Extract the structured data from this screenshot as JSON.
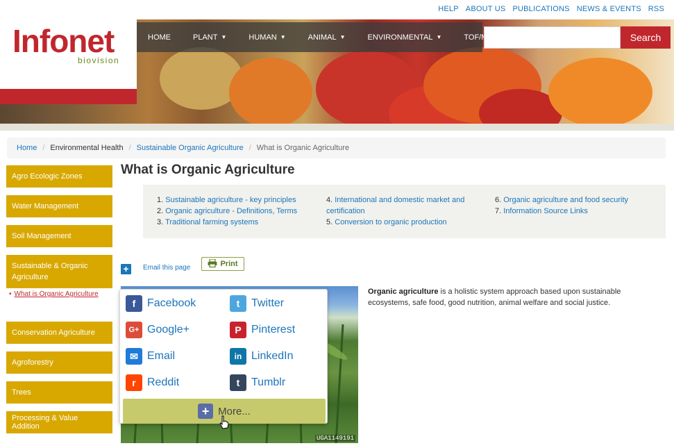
{
  "util_links": [
    "HELP",
    "ABOUT US",
    "PUBLICATIONS",
    "NEWS & EVENTS",
    "RSS"
  ],
  "logo": {
    "main": "Infonet",
    "sub": "biovision"
  },
  "nav": [
    {
      "label": "HOME",
      "dropdown": false
    },
    {
      "label": "PLANT",
      "dropdown": true
    },
    {
      "label": "HUMAN",
      "dropdown": true
    },
    {
      "label": "ANIMAL",
      "dropdown": true
    },
    {
      "label": "ENVIRONMENTAL",
      "dropdown": true
    },
    {
      "label": "TOF/MKM",
      "dropdown": false
    }
  ],
  "search": {
    "value": "",
    "placeholder": "",
    "button": "Search"
  },
  "breadcrumb": [
    {
      "label": "Home",
      "link": true
    },
    {
      "label": "Environmental Health",
      "link": false
    },
    {
      "label": "Sustainable Organic Agriculture",
      "link": true
    },
    {
      "label": "What is Organic Agriculture",
      "link": false,
      "current": true
    }
  ],
  "sidebar": {
    "items_top": [
      "Agro Ecologic Zones",
      "Water Management",
      "Soil Management",
      "Sustainable & Organic Agriculture"
    ],
    "active_sub": "What is Organic Agriculture",
    "items_bottom": [
      "Conservation Agriculture",
      "Agroforestry",
      "Trees",
      "Processing & Value Addition"
    ]
  },
  "page_title": "What is Organic Agriculture",
  "toc": {
    "col1": [
      {
        "n": "1.",
        "label": "Sustainable agriculture - key principles"
      },
      {
        "n": "2.",
        "label": "Organic agriculture - Definitions, Terms"
      },
      {
        "n": "3.",
        "label": "Traditional farming systems"
      }
    ],
    "col2": [
      {
        "n": "4.",
        "label": "International and domestic market and certification"
      },
      {
        "n": "5.",
        "label": "Conversion to organic production"
      }
    ],
    "col3": [
      {
        "n": "6.",
        "label": "Organic agriculture and food security"
      },
      {
        "n": "7.",
        "label": "Information Source Links"
      }
    ]
  },
  "share": {
    "email_label": "Email this page",
    "print_label": "Print"
  },
  "photo_id": "UGA1149191",
  "article": {
    "bold": "Organic agriculture",
    "text": " is a holistic system approach based upon sustainable ecosystems, safe food, good nutrition, animal welfare and social justice."
  },
  "share_popup": {
    "items": [
      {
        "label": "Facebook",
        "icon": "facebook-icon",
        "color": "#3b5998",
        "glyph": "f"
      },
      {
        "label": "Twitter",
        "icon": "twitter-icon",
        "color": "#4da7de",
        "glyph": "t"
      },
      {
        "label": "Google+",
        "icon": "googleplus-icon",
        "color": "#dd4b39",
        "glyph": "G+"
      },
      {
        "label": "Pinterest",
        "icon": "pinterest-icon",
        "color": "#c8232c",
        "glyph": "P"
      },
      {
        "label": "Email",
        "icon": "email-icon",
        "color": "#1e7bd8",
        "glyph": "✉"
      },
      {
        "label": "LinkedIn",
        "icon": "linkedin-icon",
        "color": "#0e76a8",
        "glyph": "in"
      },
      {
        "label": "Reddit",
        "icon": "reddit-icon",
        "color": "#ff4500",
        "glyph": "r"
      },
      {
        "label": "Tumblr",
        "icon": "tumblr-icon",
        "color": "#35465c",
        "glyph": "t"
      }
    ],
    "more_label": "More..."
  },
  "colors": {
    "brand_red": "#c0272d",
    "sidebar_gold": "#d8a800",
    "link_blue": "#1b75bb"
  }
}
